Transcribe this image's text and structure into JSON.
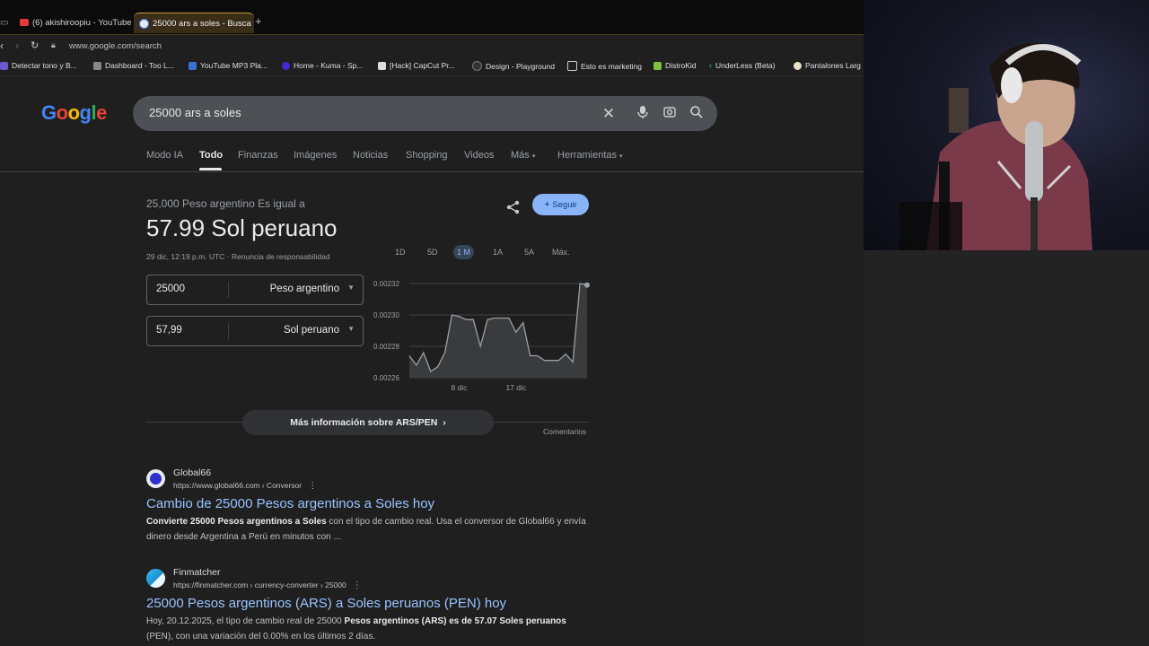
{
  "tabs": [
    {
      "label": "(6) akishiroopiu - YouTube"
    },
    {
      "label": "25000 ars a soles - Busca"
    }
  ],
  "address": "www.google.com/search",
  "bookmarks": [
    {
      "label": "Detectar tono y B..."
    },
    {
      "label": "Dashboard - Too L..."
    },
    {
      "label": "YouTube MP3 Pla..."
    },
    {
      "label": "Home - Kuma - Sp..."
    },
    {
      "label": "[Hack] CapCut Pr..."
    },
    {
      "label": "Design - Playground"
    },
    {
      "label": "Esto es marketing"
    },
    {
      "label": "DistroKid"
    },
    {
      "label": "UnderLess (Beta)"
    },
    {
      "label": "Pantalones Larg"
    }
  ],
  "search": {
    "query": "25000 ars a soles"
  },
  "nav_tabs": [
    {
      "label": "Modo IA"
    },
    {
      "label": "Todo"
    },
    {
      "label": "Finanzas"
    },
    {
      "label": "Imágenes"
    },
    {
      "label": "Noticias"
    },
    {
      "label": "Shopping"
    },
    {
      "label": "Videos"
    },
    {
      "label": "Más"
    },
    {
      "label": "Herramientas"
    }
  ],
  "converter": {
    "subtitle": "25,000 Peso argentino Es igual a",
    "result": "57.99 Sol peruano",
    "timestamp": "29 dic, 12:19 p.m. UTC",
    "disclaimer": "Renuncia de responsabilidad",
    "follow": "Seguir",
    "from_value": "25000",
    "from_currency": "Peso argentino",
    "to_value": "57,99",
    "to_currency": "Sol peruano",
    "ranges": [
      "1D",
      "5D",
      "1 M",
      "1A",
      "5A",
      "Máx."
    ],
    "more_info": "Más información sobre ARS/PEN",
    "feedback": "Comentarios"
  },
  "chart_data": {
    "type": "area",
    "y_ticks": [
      "0.00232",
      "0.00230",
      "0.00228",
      "0.00226"
    ],
    "ylim": [
      0.00226,
      0.00232
    ],
    "x_ticks": [
      "8 dic",
      "17 dic"
    ],
    "values": [
      0.002274,
      0.002268,
      0.002276,
      0.002264,
      0.002267,
      0.002276,
      0.0023,
      0.002299,
      0.002297,
      0.002297,
      0.00228,
      0.002297,
      0.002298,
      0.002298,
      0.002298,
      0.002289,
      0.002295,
      0.002274,
      0.002274,
      0.002271,
      0.002271,
      0.002271,
      0.002275,
      0.00227,
      0.00232,
      0.002319
    ]
  },
  "results": [
    {
      "site": "Global66",
      "url": "https://www.global66.com › Conversor",
      "title": "Cambio de 25000 Pesos argentinos a Soles hoy",
      "snippet_b1": "Convierte 25000 Pesos argentinos a Soles",
      "snippet_t1": " con el tipo de cambio real. Usa el conversor de Global66 y envía dinero desde Argentina a Perú en minutos con ..."
    },
    {
      "site": "Finmatcher",
      "url": "https://finmatcher.com › currency-converter › 25000",
      "title": "25000 Pesos argentinos (ARS) a Soles peruanos (PEN) hoy",
      "snippet_t0": "Hoy, 20.12.2025, el tipo de cambio real de 25000 ",
      "snippet_b1": "Pesos argentinos (ARS) es de 57.07 Soles peruanos",
      "snippet_t1": " (PEN), con una variación del 0.00% en los últimos 2 días."
    }
  ],
  "colors": {
    "accent": "#8ab4f8",
    "link": "#99c3ff",
    "bg": "#1f1f1f"
  }
}
